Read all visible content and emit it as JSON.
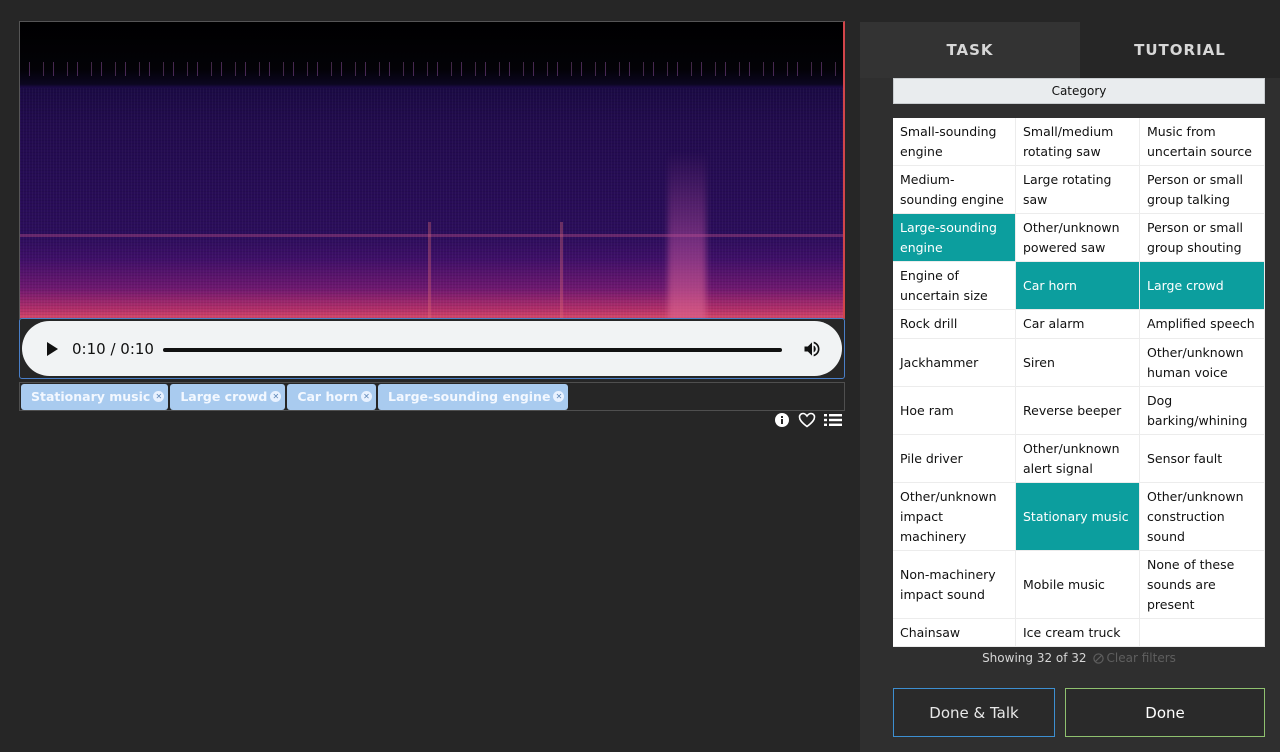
{
  "player": {
    "time": "0:10 / 0:10",
    "progress_fraction": 1.0
  },
  "tags": [
    {
      "label": "Stationary music"
    },
    {
      "label": "Large crowd"
    },
    {
      "label": "Car horn"
    },
    {
      "label": "Large-sounding engine"
    }
  ],
  "tabs": {
    "task": "TASK",
    "tutorial": "TUTORIAL"
  },
  "category_header": "Category",
  "categories": [
    {
      "label": "Small-sounding engine",
      "selected": false
    },
    {
      "label": "Small/medium rotating saw",
      "selected": false
    },
    {
      "label": "Music from uncertain source",
      "selected": false
    },
    {
      "label": "Medium-sounding engine",
      "selected": false
    },
    {
      "label": "Large rotating saw",
      "selected": false
    },
    {
      "label": "Person or small group talking",
      "selected": false
    },
    {
      "label": "Large-sounding engine",
      "selected": true
    },
    {
      "label": "Other/unknown powered saw",
      "selected": false
    },
    {
      "label": "Person or small group shouting",
      "selected": false
    },
    {
      "label": "Engine of uncertain size",
      "selected": false
    },
    {
      "label": "Car horn",
      "selected": true
    },
    {
      "label": "Large crowd",
      "selected": true
    },
    {
      "label": "Rock drill",
      "selected": false
    },
    {
      "label": "Car alarm",
      "selected": false
    },
    {
      "label": "Amplified speech",
      "selected": false
    },
    {
      "label": "Jackhammer",
      "selected": false
    },
    {
      "label": "Siren",
      "selected": false
    },
    {
      "label": "Other/unknown human voice",
      "selected": false
    },
    {
      "label": "Hoe ram",
      "selected": false
    },
    {
      "label": "Reverse beeper",
      "selected": false
    },
    {
      "label": "Dog barking/whining",
      "selected": false
    },
    {
      "label": "Pile driver",
      "selected": false
    },
    {
      "label": "Other/unknown alert signal",
      "selected": false
    },
    {
      "label": "Sensor fault",
      "selected": false
    },
    {
      "label": "Other/unknown impact machinery",
      "selected": false
    },
    {
      "label": "Stationary music",
      "selected": true
    },
    {
      "label": "Other/unknown construction sound",
      "selected": false
    },
    {
      "label": "Non-machinery impact sound",
      "selected": false
    },
    {
      "label": "Mobile music",
      "selected": false
    },
    {
      "label": "None of these sounds are present",
      "selected": false
    },
    {
      "label": "Chainsaw",
      "selected": false
    },
    {
      "label": "Ice cream truck",
      "selected": false
    }
  ],
  "showing": "Showing 32 of 32",
  "clear_filters": "Clear filters",
  "buttons": {
    "done_talk": "Done & Talk",
    "done": "Done"
  },
  "colors": {
    "selected": "#0c9e9e",
    "tag": "#a9cbef",
    "done_talk_border": "#3d8fd1",
    "done_border": "#8fc16f",
    "background": "#262626"
  },
  "icons": {
    "play": "play-icon",
    "volume": "volume-icon",
    "tag_remove": "close-circle-icon",
    "info": "info-icon",
    "favorite": "heart-icon",
    "list": "list-icon",
    "clear": "ban-icon"
  }
}
